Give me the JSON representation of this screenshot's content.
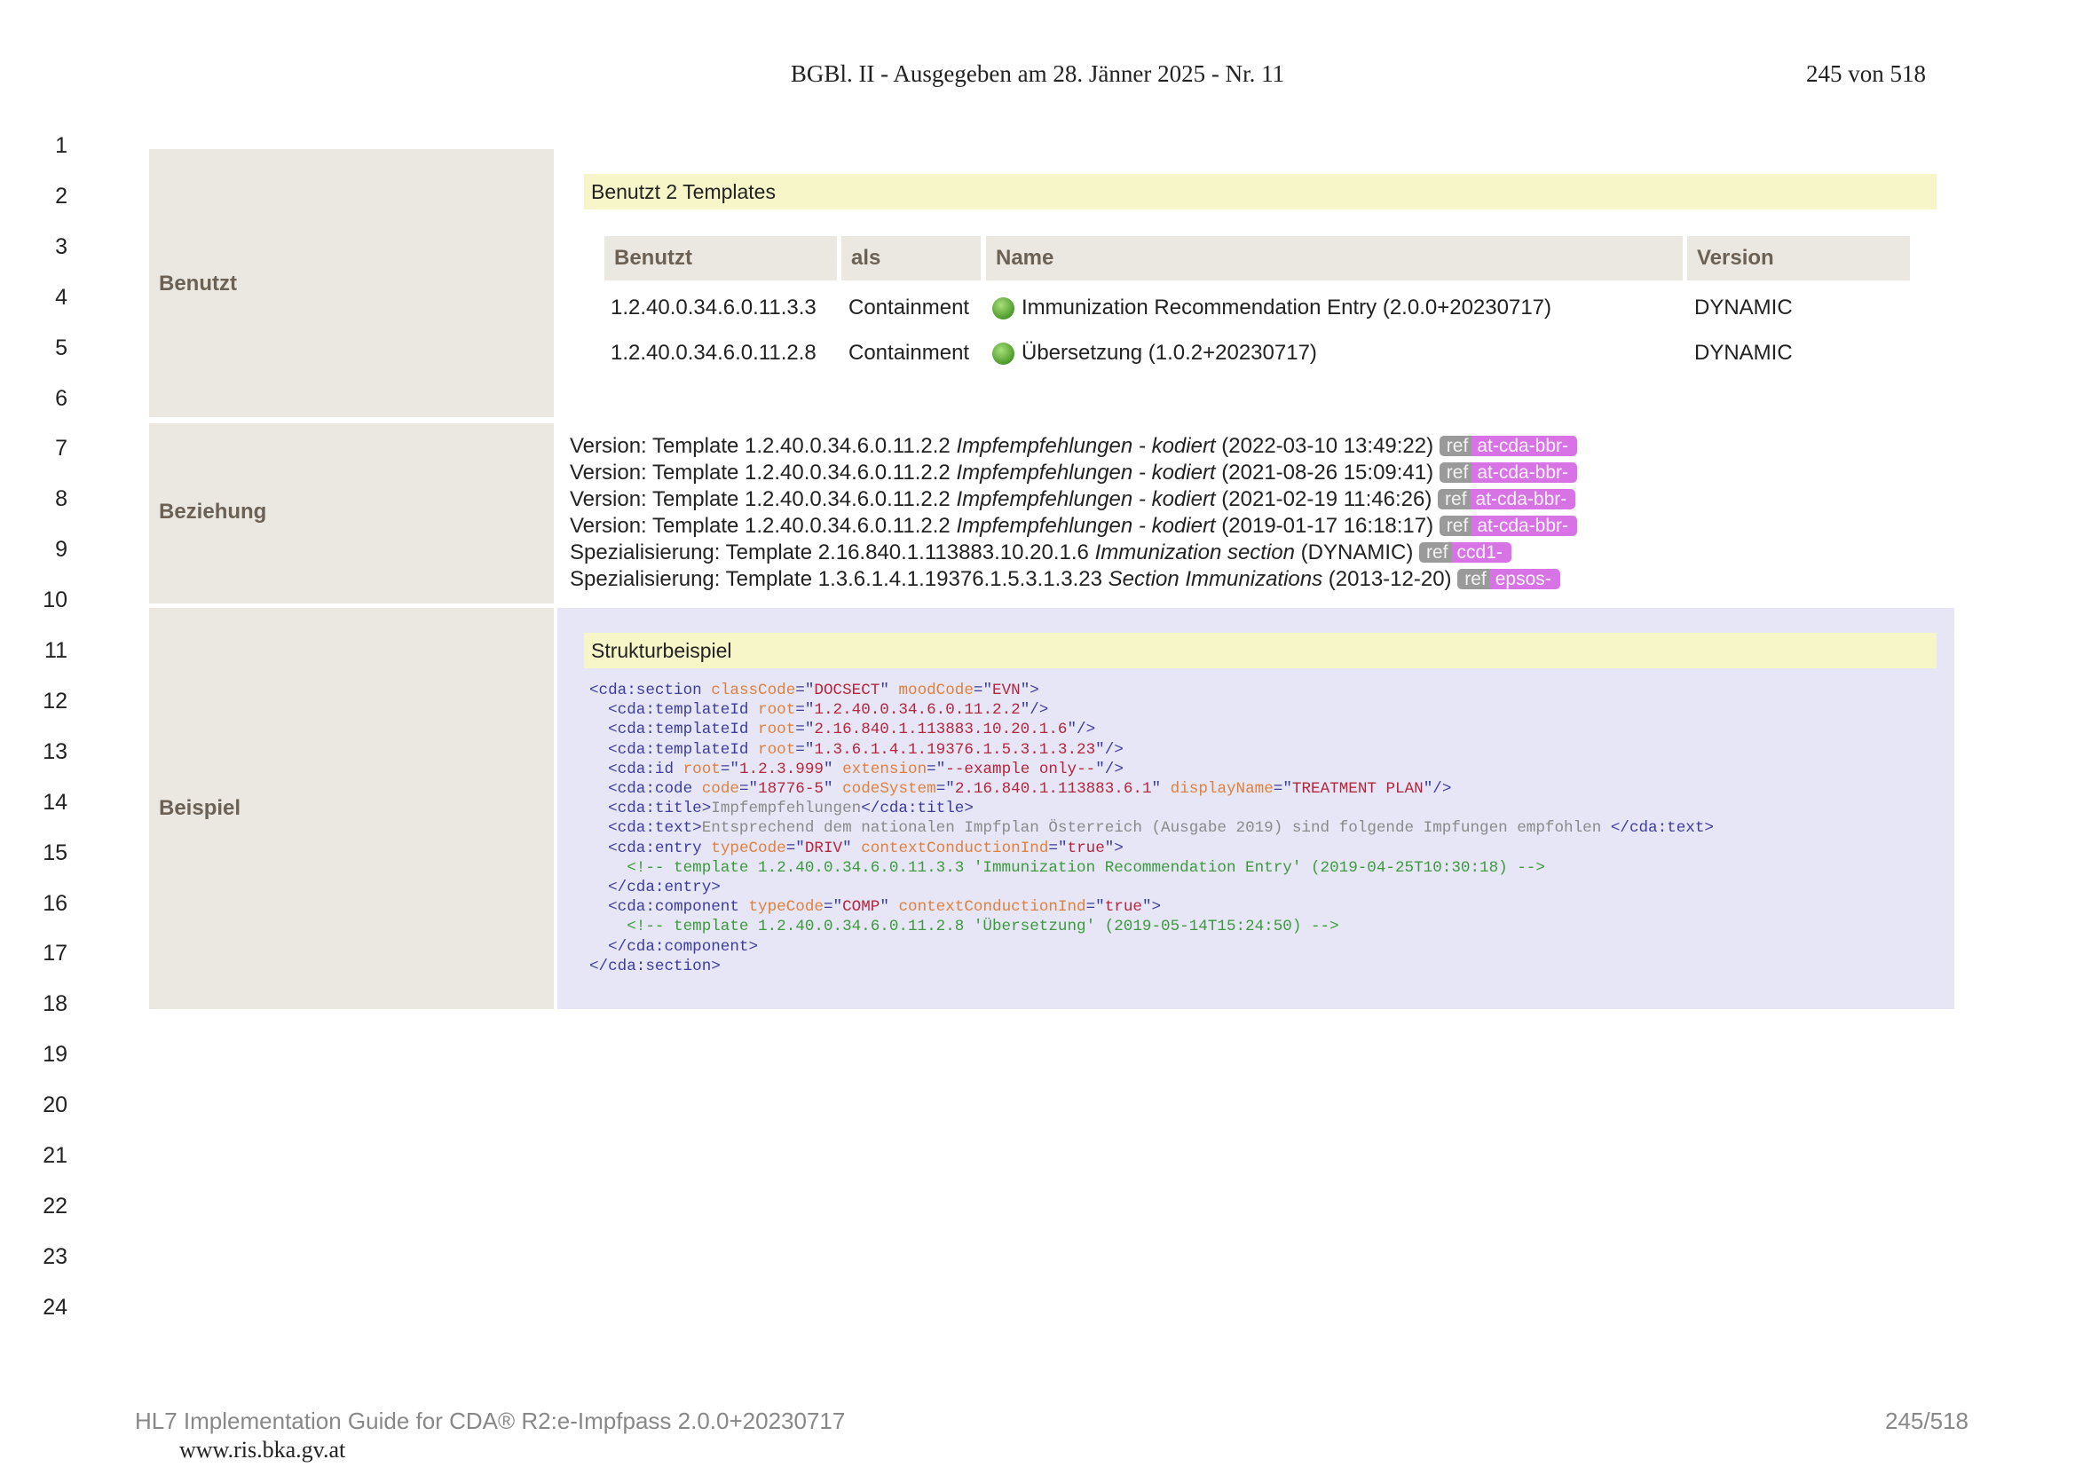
{
  "header": {
    "center": "BGBl. II - Ausgegeben am 28. Jänner 2025 - Nr. 11",
    "right": "245 von 518"
  },
  "line_numbers": [
    "1",
    "2",
    "3",
    "4",
    "5",
    "6",
    "7",
    "8",
    "9",
    "10",
    "11",
    "12",
    "13",
    "14",
    "15",
    "16",
    "17",
    "18",
    "19",
    "20",
    "21",
    "22",
    "23",
    "24"
  ],
  "benutzt": {
    "label": "Benutzt",
    "bar": "Benutzt 2 Templates",
    "headers": [
      "Benutzt",
      "als",
      "Name",
      "Version"
    ],
    "rows": [
      {
        "id": "1.2.40.0.34.6.0.11.3.3",
        "als": "Containment",
        "name": "Immunization Recommendation Entry (2.0.0+20230717)",
        "version": "DYNAMIC"
      },
      {
        "id": "1.2.40.0.34.6.0.11.2.8",
        "als": "Containment",
        "name": "Übersetzung (1.0.2+20230717)",
        "version": "DYNAMIC"
      }
    ]
  },
  "beziehung": {
    "label": "Beziehung",
    "rows": [
      {
        "prefix": "Version: Template 1.2.40.0.34.6.0.11.2.2",
        "name": "Impfempfehlungen - kodiert",
        "suffix": "(2022‑03‑10 13:49:22)",
        "ref": "ref",
        "tag": "at-cda-bbr-"
      },
      {
        "prefix": "Version: Template 1.2.40.0.34.6.0.11.2.2",
        "name": "Impfempfehlungen - kodiert",
        "suffix": "(2021‑08‑26 15:09:41)",
        "ref": "ref",
        "tag": "at-cda-bbr-"
      },
      {
        "prefix": "Version: Template 1.2.40.0.34.6.0.11.2.2",
        "name": "Impfempfehlungen - kodiert",
        "suffix": "(2021‑02‑19 11:46:26)",
        "ref": "ref",
        "tag": "at-cda-bbr-"
      },
      {
        "prefix": "Version: Template 1.2.40.0.34.6.0.11.2.2",
        "name": "Impfempfehlungen - kodiert",
        "suffix": "(2019‑01‑17 16:18:17)",
        "ref": "ref",
        "tag": "at-cda-bbr-"
      },
      {
        "prefix": "Spezialisierung: Template 2.16.840.1.113883.10.20.1.6",
        "name": "Immunization section",
        "suffix": "(DYNAMIC)",
        "ref": "ref",
        "tag": "ccd1-"
      },
      {
        "prefix": "Spezialisierung: Template 1.3.6.1.4.1.19376.1.5.3.1.3.23",
        "name": "Section Immunizations",
        "suffix": "(2013‑12‑20)",
        "ref": "ref",
        "tag": "epsos-"
      }
    ]
  },
  "beispiel": {
    "label": "Beispiel",
    "bar": "Strukturbeispiel",
    "code_lines": [
      [
        [
          "k",
          "<cda:section "
        ],
        [
          "a",
          "classCode"
        ],
        [
          "k",
          "=\""
        ],
        [
          "v",
          "DOCSECT"
        ],
        [
          "k",
          "\" "
        ],
        [
          "a",
          "moodCode"
        ],
        [
          "k",
          "=\""
        ],
        [
          "v",
          "EVN"
        ],
        [
          "k",
          "\">"
        ]
      ],
      [
        [
          "k",
          "  <cda:templateId "
        ],
        [
          "a",
          "root"
        ],
        [
          "k",
          "=\""
        ],
        [
          "v",
          "1.2.40.0.34.6.0.11.2.2"
        ],
        [
          "k",
          "\"/>"
        ]
      ],
      [
        [
          "k",
          "  <cda:templateId "
        ],
        [
          "a",
          "root"
        ],
        [
          "k",
          "=\""
        ],
        [
          "v",
          "2.16.840.1.113883.10.20.1.6"
        ],
        [
          "k",
          "\"/>"
        ]
      ],
      [
        [
          "k",
          "  <cda:templateId "
        ],
        [
          "a",
          "root"
        ],
        [
          "k",
          "=\""
        ],
        [
          "v",
          "1.3.6.1.4.1.19376.1.5.3.1.3.23"
        ],
        [
          "k",
          "\"/>"
        ]
      ],
      [
        [
          "k",
          "  <cda:id "
        ],
        [
          "a",
          "root"
        ],
        [
          "k",
          "=\""
        ],
        [
          "v",
          "1.2.3.999"
        ],
        [
          "k",
          "\" "
        ],
        [
          "a",
          "extension"
        ],
        [
          "k",
          "=\""
        ],
        [
          "v",
          "--example only--"
        ],
        [
          "k",
          "\"/>"
        ]
      ],
      [
        [
          "k",
          "  <cda:code "
        ],
        [
          "a",
          "code"
        ],
        [
          "k",
          "=\""
        ],
        [
          "v",
          "18776-5"
        ],
        [
          "k",
          "\" "
        ],
        [
          "a",
          "codeSystem"
        ],
        [
          "k",
          "=\""
        ],
        [
          "v",
          "2.16.840.1.113883.6.1"
        ],
        [
          "k",
          "\" "
        ],
        [
          "a",
          "displayName"
        ],
        [
          "k",
          "=\""
        ],
        [
          "v",
          "TREATMENT PLAN"
        ],
        [
          "k",
          "\"/>"
        ]
      ],
      [
        [
          "k",
          "  <cda:title>"
        ],
        [
          "t",
          "Impfempfehlungen"
        ],
        [
          "k",
          "</cda:title>"
        ]
      ],
      [
        [
          "k",
          "  <cda:text>"
        ],
        [
          "t",
          "Entsprechend dem nationalen Impfplan Österreich (Ausgabe 2019) sind folgende Impfungen empfohlen "
        ],
        [
          "k",
          "</cda:text>"
        ]
      ],
      [
        [
          "k",
          "  <cda:entry "
        ],
        [
          "a",
          "typeCode"
        ],
        [
          "k",
          "=\""
        ],
        [
          "v",
          "DRIV"
        ],
        [
          "k",
          "\" "
        ],
        [
          "a",
          "contextConductionInd"
        ],
        [
          "k",
          "=\""
        ],
        [
          "v",
          "true"
        ],
        [
          "k",
          "\">"
        ]
      ],
      [
        [
          "c",
          "    <!-- template 1.2.40.0.34.6.0.11.3.3 'Immunization Recommendation Entry' (2019-04-25T10:30:18) -->"
        ]
      ],
      [
        [
          "k",
          "  </cda:entry>"
        ]
      ],
      [
        [
          "k",
          "  <cda:component "
        ],
        [
          "a",
          "typeCode"
        ],
        [
          "k",
          "=\""
        ],
        [
          "v",
          "COMP"
        ],
        [
          "k",
          "\" "
        ],
        [
          "a",
          "contextConductionInd"
        ],
        [
          "k",
          "=\""
        ],
        [
          "v",
          "true"
        ],
        [
          "k",
          "\">"
        ]
      ],
      [
        [
          "c",
          "    <!-- template 1.2.40.0.34.6.0.11.2.8 'Übersetzung' (2019-05-14T15:24:50) -->"
        ]
      ],
      [
        [
          "k",
          "  </cda:component>"
        ]
      ],
      [
        [
          "k",
          "</cda:section>"
        ]
      ]
    ]
  },
  "footer": {
    "left": "HL7 Implementation Guide for CDA® R2:e-Impfpass 2.0.0+20230717",
    "right": "245/518",
    "url": "www.ris.bka.gv.at"
  }
}
